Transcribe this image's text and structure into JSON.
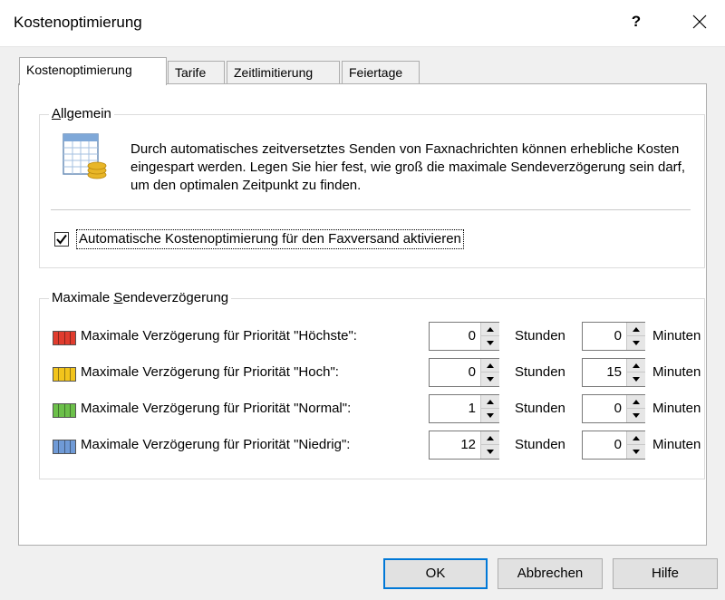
{
  "window": {
    "title": "Kostenoptimierung",
    "help_label": "?",
    "close_label": "✕"
  },
  "tabs": [
    {
      "label": "Kostenoptimierung",
      "active": true
    },
    {
      "label": "Tarife",
      "active": false
    },
    {
      "label": "Zeitlimitierung",
      "active": false
    },
    {
      "label": "Feiertage",
      "active": false
    }
  ],
  "general": {
    "legend_prefix": "",
    "legend_access": "A",
    "legend_suffix": "llgemein",
    "icon": "spreadsheet-coins-icon",
    "description": "Durch automatisches zeitversetztes Senden von Faxnachrichten können erhebliche Kosten eingespart werden. Legen Sie hier fest, wie groß die maximale Sendeverzögerung sein darf, um den optimalen Zeitpunkt zu finden.",
    "checkbox_checked": true,
    "checkbox_label": "Automatische Kostenoptimierung für den Faxversand aktivieren"
  },
  "delay": {
    "legend_prefix": "Maximale ",
    "legend_access": "S",
    "legend_suffix": "endeverzögerung",
    "hours_unit": "Stunden",
    "minutes_unit": "Minuten",
    "rows": [
      {
        "label": "Maximale Verzögerung für Priorität \"Höchste\":",
        "hours": "0",
        "minutes": "0",
        "color": "#e03c2e"
      },
      {
        "label": "Maximale Verzögerung für Priorität \"Hoch\":",
        "hours": "0",
        "minutes": "15",
        "color": "#f2c41c"
      },
      {
        "label": "Maximale Verzögerung für Priorität \"Normal\":",
        "hours": "1",
        "minutes": "0",
        "color": "#6cc04a"
      },
      {
        "label": "Maximale Verzögerung für Priorität \"Niedrig\":",
        "hours": "12",
        "minutes": "0",
        "color": "#6f9ad6"
      }
    ]
  },
  "buttons": {
    "ok": "OK",
    "cancel": "Abbrechen",
    "help": "Hilfe"
  }
}
